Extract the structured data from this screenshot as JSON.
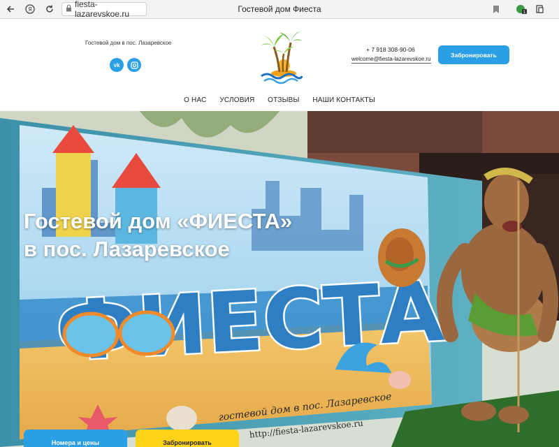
{
  "browser": {
    "back_icon": "arrow-left-icon",
    "url": "fiesta-lazarevskoe.ru",
    "tab_title": "Гостевой дом Фиеста"
  },
  "header": {
    "tagline": "Гостевой дом в пос. Лазаревское",
    "social": {
      "vk": "vk",
      "instagram": "instagram-icon"
    },
    "phone": "+ 7 918 308-90-06",
    "email": "welcome@fiesta-lazarevskoe.ru",
    "book_button": "Забронировать",
    "accent_color": "#2b9fe6"
  },
  "nav": {
    "items": [
      {
        "label": "О НАС"
      },
      {
        "label": "УСЛОВИЯ"
      },
      {
        "label": "ОТЗЫВЫ"
      },
      {
        "label": "НАШИ КОНТАКТЫ"
      }
    ]
  },
  "hero": {
    "title_line1": "Гостевой дом «ФИЕСТА»",
    "title_line2": "в пос. Лазаревское",
    "banner_word": "ФИЕСТА",
    "banner_subtitle": "гостевой дом в пос. Лазаревское",
    "banner_url": "http://fiesta-lazarevskoe.ru",
    "button_rooms": "Номера и цены",
    "button_book": "Забронировать",
    "yellow_color": "#ffd21a"
  }
}
